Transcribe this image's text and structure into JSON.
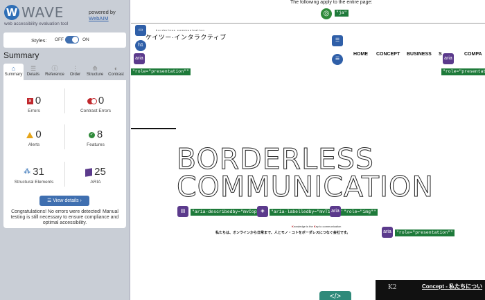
{
  "wave": {
    "logo_letter": "W",
    "logo_word": "WAVE",
    "tagline": "web accessibility evaluation tool",
    "powered_by": "powered by",
    "powered_link": "WebAIM",
    "styles_label": "Styles:",
    "styles_off": "OFF",
    "styles_on": "ON",
    "summary_heading": "Summary",
    "tabs": [
      {
        "label": "Summary",
        "icon": "home-icon"
      },
      {
        "label": "Details",
        "icon": "list-icon"
      },
      {
        "label": "Reference",
        "icon": "info-icon"
      },
      {
        "label": "Order",
        "icon": "order-icon"
      },
      {
        "label": "Structure",
        "icon": "structure-icon"
      },
      {
        "label": "Contrast",
        "icon": "contrast-icon"
      }
    ],
    "stats": {
      "errors": {
        "value": "0",
        "label": "Errors"
      },
      "contrast_errors": {
        "value": "0",
        "label": "Contrast Errors"
      },
      "alerts": {
        "value": "0",
        "label": "Alerts"
      },
      "features": {
        "value": "8",
        "label": "Features"
      },
      "structural": {
        "value": "31",
        "label": "Structural Elements"
      },
      "aria": {
        "value": "25",
        "label": "ARIA"
      }
    },
    "view_details": "View details ›",
    "congrats": "Congratulations! No errors were detected! Manual testing is still necessary to ensure compliance and optimal accessibility.",
    "colors": {
      "accent": "#3f6fb0",
      "error": "#c0282d",
      "alert": "#e6a519",
      "feature": "#2f8a3a",
      "aria": "#5b3a8c"
    }
  },
  "page": {
    "apply_text": "The following apply to the entire page:",
    "lang_tag": "\"ja\"",
    "brand_small": "borderless communication",
    "brand": "ケイツー·インタラクティブ",
    "h1": "h1",
    "aria": "aria",
    "nav": [
      "HOME",
      "CONCEPT",
      "BUSINESS",
      "S",
      "COMPA"
    ],
    "role_presentation": "\"role=\"presentation\"\"",
    "hero_line1": "BORDERLESS",
    "hero_line2": "COMMUNICATION",
    "describedby": "\"aria-describedby=\"mvCopy\"\"",
    "labelledby": "\"aria-labelledby=\"mvTitle\"\"",
    "role_img": "\"role=\"img\"\"",
    "knowledge_pre": "K",
    "knowledge_mid": "nowledge is the ",
    "knowledge_key": "K",
    "knowledge_post": "ey to communication",
    "jp_copy": "私たちは、オンラインから日常まで、人とモノ・コトをボーダレスにつなぐ会社です。",
    "code_icon": "</>",
    "dark_logo": "K2",
    "dark_title": "Concept - 私たちについ"
  }
}
